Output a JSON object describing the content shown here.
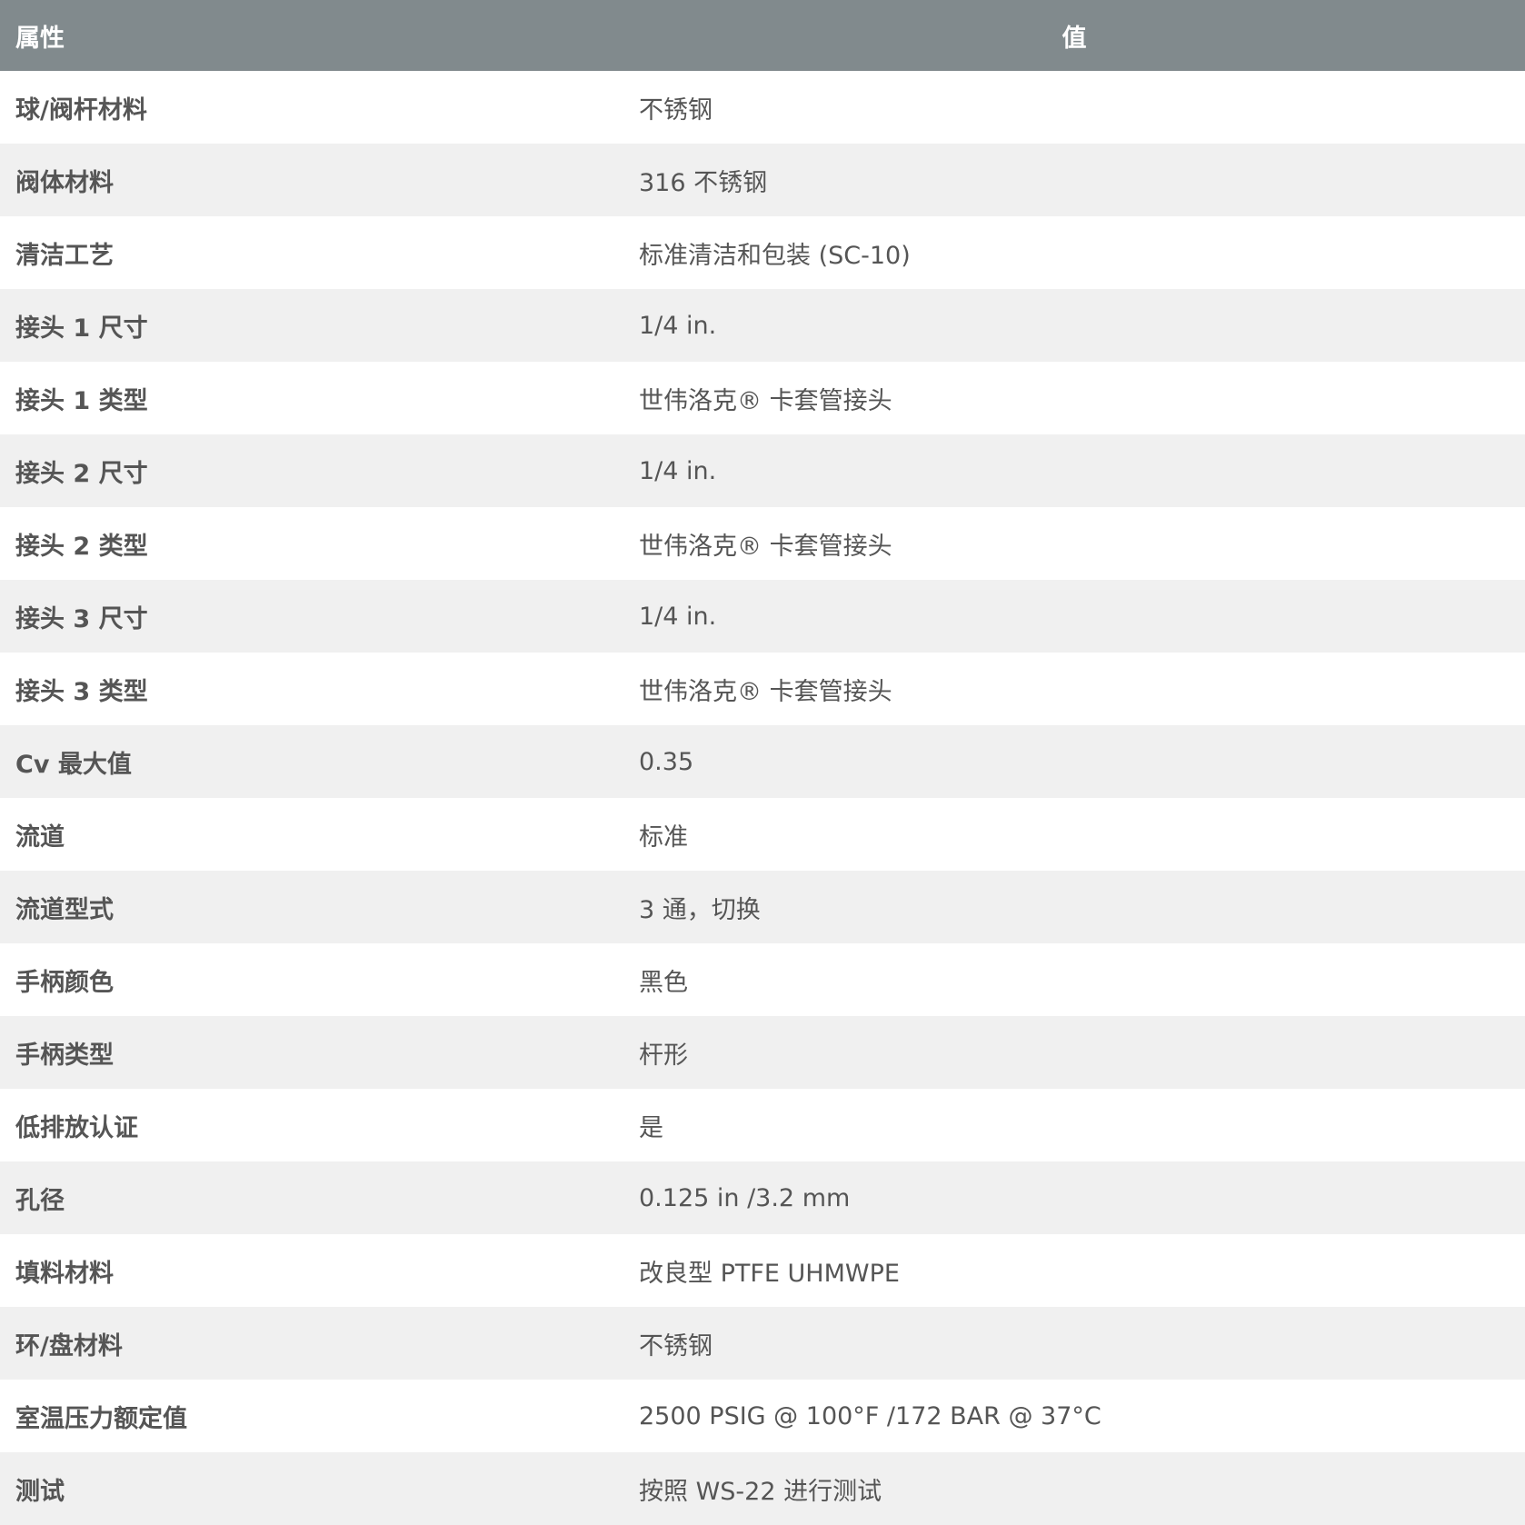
{
  "header": {
    "attribute_label": "属性",
    "value_label": "值"
  },
  "rows": [
    {
      "attribute": "球/阀杆材料",
      "value": "不锈钢"
    },
    {
      "attribute": "阀体材料",
      "value": "316 不锈钢"
    },
    {
      "attribute": "清洁工艺",
      "value": "标准清洁和包装 (SC-10)"
    },
    {
      "attribute": "接头 1 尺寸",
      "value": "1/4 in."
    },
    {
      "attribute": "接头 1 类型",
      "value": "世伟洛克® 卡套管接头"
    },
    {
      "attribute": "接头 2 尺寸",
      "value": "1/4 in."
    },
    {
      "attribute": "接头 2 类型",
      "value": "世伟洛克® 卡套管接头"
    },
    {
      "attribute": "接头 3 尺寸",
      "value": "1/4 in."
    },
    {
      "attribute": "接头 3 类型",
      "value": "世伟洛克® 卡套管接头"
    },
    {
      "attribute": "Cv 最大值",
      "value": "0.35"
    },
    {
      "attribute": "流道",
      "value": "标准"
    },
    {
      "attribute": "流道型式",
      "value": "3 通，切换"
    },
    {
      "attribute": "手柄颜色",
      "value": "黑色"
    },
    {
      "attribute": "手柄类型",
      "value": "杆形"
    },
    {
      "attribute": "低排放认证",
      "value": "是"
    },
    {
      "attribute": "孔径",
      "value": "0.125 in /3.2 mm"
    },
    {
      "attribute": "填料材料",
      "value": "改良型 PTFE UHMWPE"
    },
    {
      "attribute": "环/盘材料",
      "value": "不锈钢"
    },
    {
      "attribute": "室温压力额定值",
      "value": "2500 PSIG @ 100°F /172 BAR @ 37°C"
    },
    {
      "attribute": "测试",
      "value": "按照 WS-22 进行测试"
    }
  ]
}
